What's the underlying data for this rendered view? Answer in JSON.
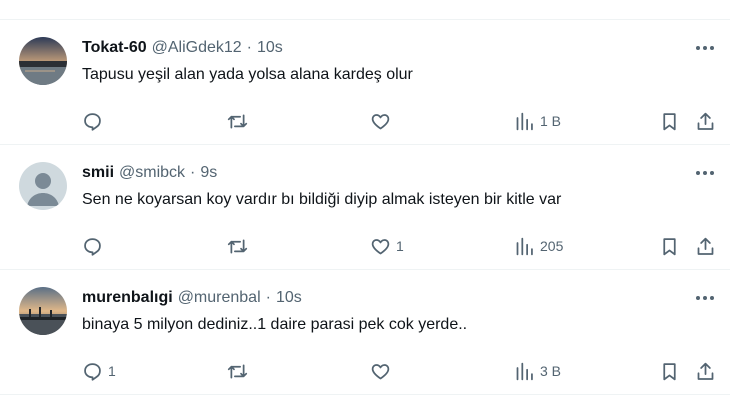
{
  "tweets": [
    {
      "name": "Tokat-60",
      "handle": "@AliGdek12",
      "time": "10s",
      "text": "Tapusu yeşil alan yada yolsa alana kardeş olur",
      "replies": "",
      "retweets": "",
      "likes": "",
      "views": "1 B",
      "avatar_type": "photo-sunset-lake"
    },
    {
      "name": "smii",
      "handle": "@smibck",
      "time": "9s",
      "text": "Sen ne koyarsan koy vardır bı bildiği diyip almak isteyen bir kitle var",
      "replies": "",
      "retweets": "",
      "likes": "1",
      "views": "205",
      "avatar_type": "default-profile"
    },
    {
      "name": "murenbalıgi",
      "handle": "@murenbal",
      "time": "10s",
      "text": "binaya 5 milyon dediniz..1 daire parasi pek cok yerde..",
      "replies": "1",
      "retweets": "",
      "likes": "",
      "views": "3 B",
      "avatar_type": "photo-sunset-pier"
    }
  ],
  "separator": "·",
  "icons": {
    "reply": "reply-icon",
    "retweet": "retweet-icon",
    "like": "heart-icon",
    "views": "analytics-icon",
    "bookmark": "bookmark-icon",
    "share": "share-icon",
    "more": "more-icon"
  },
  "colors": {
    "text": "#0f1419",
    "secondary": "#536471",
    "divider": "#eff3f4"
  }
}
